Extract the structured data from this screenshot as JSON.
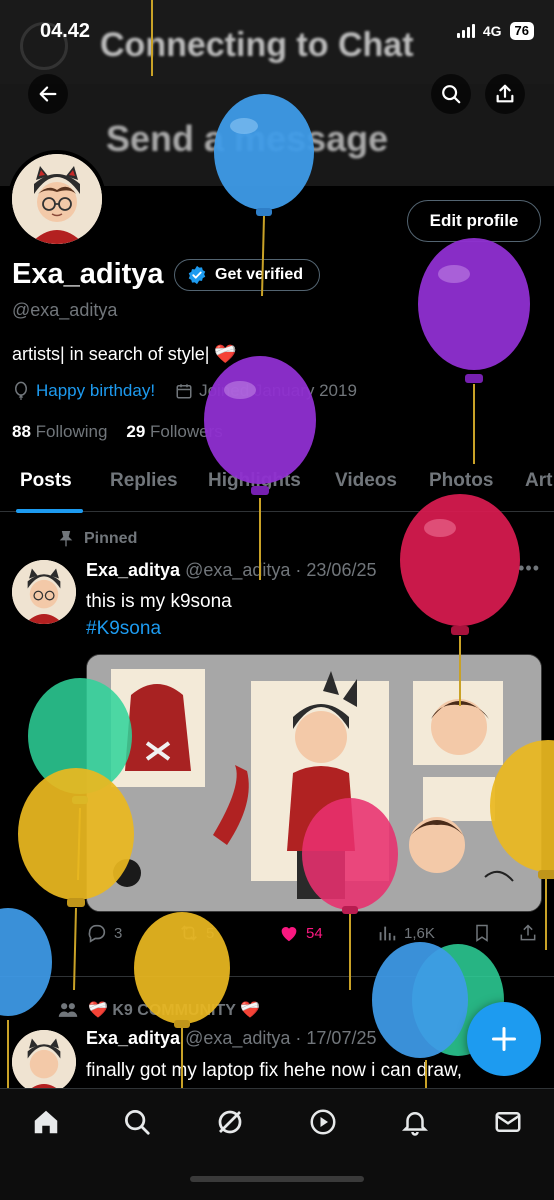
{
  "status": {
    "time": "04.42",
    "network": "4G",
    "battery": "76"
  },
  "overlay": {
    "connecting": "Connecting to Chat",
    "send_message": "Send a message"
  },
  "profile": {
    "name": "Exa_aditya",
    "handle": "@exa_aditya",
    "edit_label": "Edit profile",
    "verify_label": "Get verified",
    "bio": "artists| in search of style| ❤️‍🩹",
    "birthday": "Happy birthday!",
    "joined": "Joined January 2019",
    "following_count": "88",
    "following_label": "Following",
    "followers_count": "29",
    "followers_label": "Followers"
  },
  "tabs": [
    "Posts",
    "Replies",
    "Highlights",
    "Videos",
    "Photos",
    "Art"
  ],
  "pinned_post": {
    "pinned_label": "Pinned",
    "author": "Exa_aditya",
    "meta": "@exa_aditya · 23/06/25",
    "text": "this is my k9sona",
    "hashtag": "#K9sona",
    "replies": "3",
    "reposts": "5",
    "likes": "54",
    "views": "1,6K"
  },
  "second_post": {
    "community_label": "❤️‍🩹 K9 COMMUNITY ❤️‍🩹",
    "author": "Exa_aditya",
    "meta": "@exa_aditya · 17/07/25",
    "text": "finally got my laptop fix hehe now i can draw,"
  },
  "colors": {
    "accent": "#1d9bf0",
    "like": "#f91880",
    "background": "#000000"
  }
}
